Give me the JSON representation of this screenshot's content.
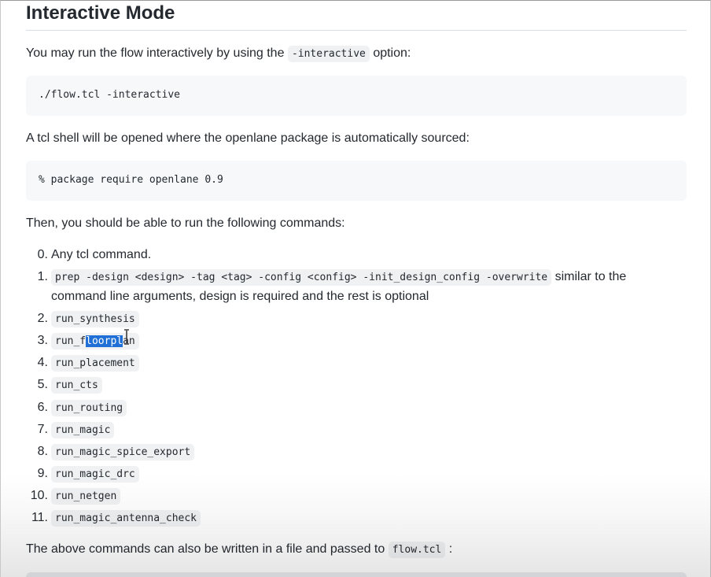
{
  "heading": "Interactive Mode",
  "intro": {
    "before": "You may run the flow interactively by using the",
    "code": "-interactive",
    "after": "option:"
  },
  "code_block_1": "./flow.tcl -interactive",
  "tcl_shell_text": "A tcl shell will be opened where the openlane package is automatically sourced:",
  "code_block_2": "% package require openlane 0.9",
  "commands_intro": "Then, you should be able to run the following commands:",
  "commands": [
    {
      "num": "0.",
      "text": "Any tcl command."
    },
    {
      "num": "1.",
      "code": "prep -design <design> -tag <tag> -config <config> -init_design_config -overwrite",
      "text": "similar to the command line arguments, design is required and the rest is optional"
    },
    {
      "num": "2.",
      "code": "run_synthesis"
    },
    {
      "num": "3.",
      "code_before": "run_f",
      "code_selected": "loorpl",
      "code_after": "an"
    },
    {
      "num": "4.",
      "code": "run_placement"
    },
    {
      "num": "5.",
      "code": "run_cts"
    },
    {
      "num": "6.",
      "code": "run_routing"
    },
    {
      "num": "7.",
      "code": "run_magic"
    },
    {
      "num": "8.",
      "code": "run_magic_spice_export"
    },
    {
      "num": "9.",
      "code": "run_magic_drc"
    },
    {
      "num": "10.",
      "code": "run_netgen"
    },
    {
      "num": "11.",
      "code": "run_magic_antenna_check"
    }
  ],
  "outro": {
    "before": "The above commands can also be written in a file and passed to",
    "code": "flow.tcl",
    "after": ":"
  },
  "icons": {
    "cursor": "text-cursor-icon"
  },
  "colors": {
    "selection": "#1f6fd6",
    "code_bg": "#eff1f3",
    "block_bg": "#f6f8fa"
  }
}
